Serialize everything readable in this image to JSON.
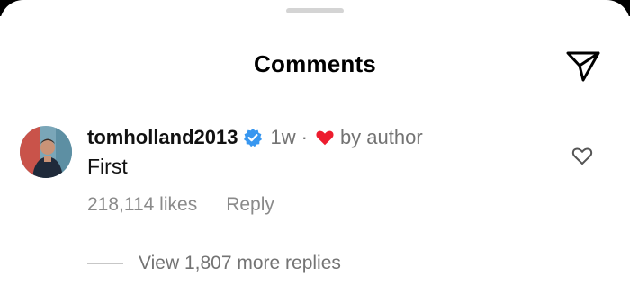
{
  "header": {
    "title": "Comments"
  },
  "comment": {
    "username": "tomholland2013",
    "time": "1w",
    "separator": "·",
    "liked_by_author_label": "by author",
    "text": "First",
    "likes": "218,114 likes",
    "reply_label": "Reply",
    "view_replies_label": "View 1,807 more replies"
  },
  "icons": {
    "share": "paper-plane-icon",
    "verified": "verified-badge-icon",
    "author_heart": "heart-filled-icon",
    "like": "heart-outline-icon"
  },
  "colors": {
    "verified_blue": "#3897f0",
    "author_heart_red": "#ed1c2e",
    "muted_text": "#737373"
  }
}
